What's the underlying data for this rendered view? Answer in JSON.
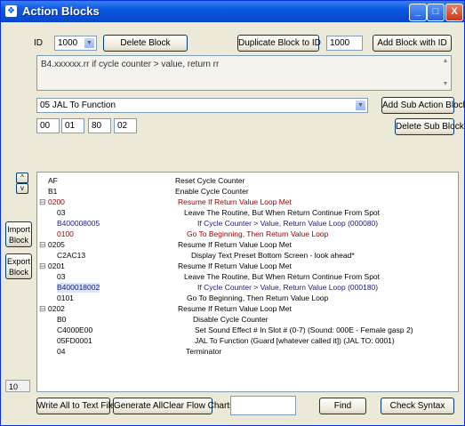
{
  "window": {
    "title": "Action Blocks",
    "min_label": "_",
    "max_label": "□",
    "close_label": "X"
  },
  "top": {
    "id_label": "ID",
    "id_value": "1000",
    "delete_block": "Delete Block",
    "duplicate_block": "Duplicate Block to ID",
    "dup_id_value": "1000",
    "add_block": "Add Block with ID"
  },
  "description_text": "B4.xxxxxx.rr if cycle counter > value, return rr",
  "subaction": {
    "selected": "05 JAL To Function",
    "params": [
      "00",
      "01",
      "80",
      "02"
    ],
    "add_sub": "Add Sub Action Block",
    "delete_sub": "Delete Sub Block"
  },
  "side": {
    "up": "^",
    "down": "v",
    "import": "Import Block",
    "export": "Export Block",
    "count": "10"
  },
  "tree": [
    {
      "pm": "",
      "code": "AF",
      "desc": "Reset Cycle Counter",
      "indent": 1,
      "descx": 155,
      "color": "",
      "selected": false
    },
    {
      "pm": "",
      "code": "B1",
      "desc": "Enable Cycle Counter",
      "indent": 1,
      "descx": 155,
      "color": "",
      "selected": false
    },
    {
      "pm": "⊟",
      "code": "0200",
      "desc": "Resume If Return Value Loop Met",
      "indent": 1,
      "descx": 158,
      "color": "red",
      "selected": false
    },
    {
      "pm": "",
      "code": "03",
      "desc": "Leave The Routine, But When Return Continue From Spot",
      "indent": 2,
      "descx": 165,
      "color": "",
      "selected": false
    },
    {
      "pm": "",
      "code": "B400008005",
      "desc": "If Cycle Counter > Value, Return Value Loop (000080)",
      "indent": 2,
      "descx": 180,
      "color": "navy",
      "selected": false
    },
    {
      "pm": "",
      "code": "0100",
      "desc": "Go To Beginning, Then Return Value Loop",
      "indent": 2,
      "descx": 168,
      "color": "red",
      "selected": false
    },
    {
      "pm": "⊟",
      "code": "0205",
      "desc": "Resume If Return Value Loop Met",
      "indent": 1,
      "descx": 158,
      "color": "",
      "selected": false
    },
    {
      "pm": "",
      "code": "C2AC13",
      "desc": "Display Text Preset Bottom Screen - look ahead*",
      "indent": 2,
      "descx": 173,
      "color": "",
      "selected": false
    },
    {
      "pm": "⊟",
      "code": "0201",
      "desc": "Resume If Return Value Loop Met",
      "indent": 1,
      "descx": 158,
      "color": "",
      "selected": false
    },
    {
      "pm": "",
      "code": "03",
      "desc": "Leave The Routine, But When Return Continue From Spot",
      "indent": 2,
      "descx": 165,
      "color": "",
      "selected": false
    },
    {
      "pm": "",
      "code": "B400018002",
      "desc": "If Cycle Counter > Value, Return Value Loop (000180)",
      "indent": 2,
      "descx": 180,
      "color": "navy",
      "selected": true
    },
    {
      "pm": "",
      "code": "0101",
      "desc": "Go To Beginning, Then Return Value Loop",
      "indent": 2,
      "descx": 168,
      "color": "",
      "selected": false
    },
    {
      "pm": "⊟",
      "code": "0202",
      "desc": "Resume If Return Value Loop Met",
      "indent": 1,
      "descx": 158,
      "color": "",
      "selected": false
    },
    {
      "pm": "",
      "code": "B0",
      "desc": "Disable Cycle Counter",
      "indent": 2,
      "descx": 175,
      "color": "",
      "selected": false
    },
    {
      "pm": "",
      "code": "C4000E00",
      "desc": "Set Sound Effect # In Slot # (0-7) (Sound: 000E - Female gasp 2)",
      "indent": 2,
      "descx": 177,
      "color": "",
      "selected": false
    },
    {
      "pm": "",
      "code": "05FD0001",
      "desc": "JAL To Function (Guard [whatever called it]) (JAL TO: 0001)",
      "indent": 2,
      "descx": 177,
      "color": "",
      "selected": false
    },
    {
      "pm": "",
      "code": "04",
      "desc": "Terminator",
      "indent": 2,
      "descx": 167,
      "color": "",
      "selected": false
    }
  ],
  "bottom": {
    "write_all": "Write All to Text File",
    "gen_charts": "Generate AllClear Flow Charts",
    "search_value": "",
    "find": "Find",
    "check_syntax": "Check Syntax"
  }
}
